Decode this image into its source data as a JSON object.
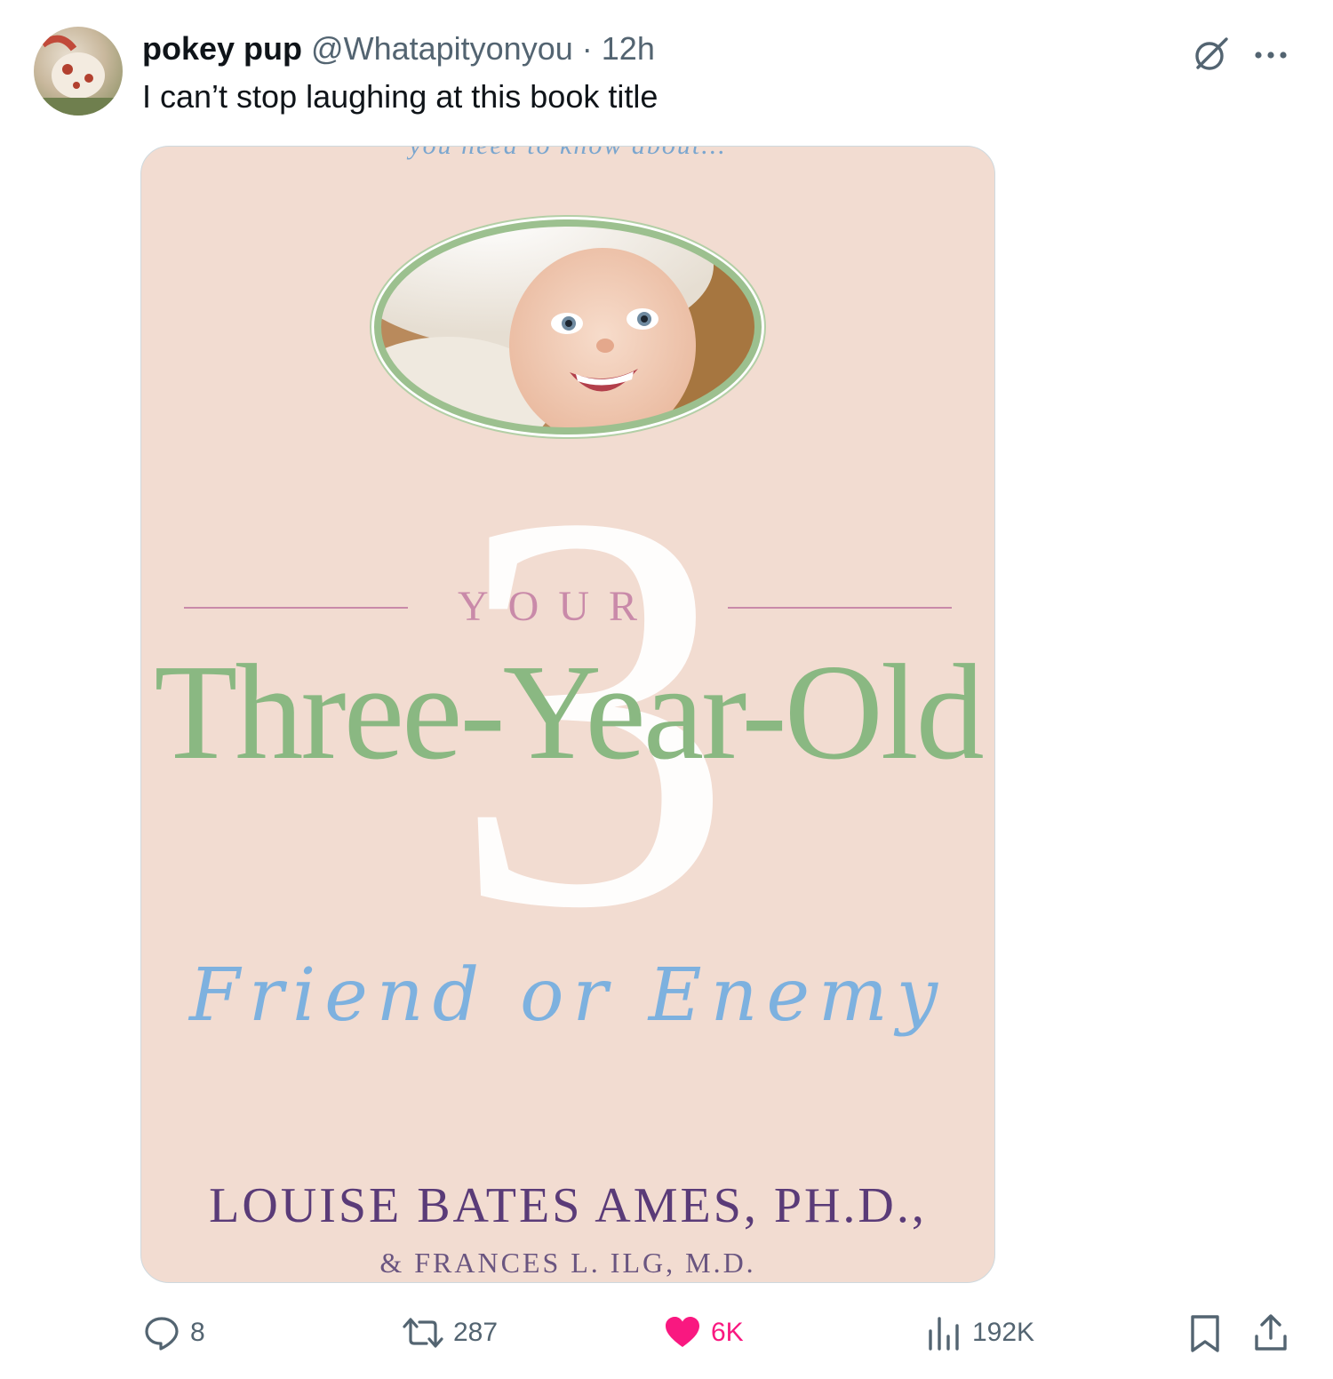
{
  "tweet": {
    "author_name": "pokey pup",
    "handle": "@Whatapityonyou",
    "separator": "·",
    "time": "12h",
    "text": "I can’t stop laughing at this book title"
  },
  "book_cover": {
    "top_partial_text": "you need to know about...",
    "big_numeral": "3",
    "your_label": "YOUR",
    "title": "Three-Year-Old",
    "subtitle": "Friend or Enemy",
    "author": "LOUISE BATES AMES, PH.D.,",
    "coauthor": "& FRANCES L. ILG, M.D."
  },
  "actions": {
    "replies": "8",
    "reposts": "287",
    "likes": "6K",
    "views": "192K"
  },
  "icons": {
    "reply": "reply-icon",
    "repost": "repost-icon",
    "like": "heart-icon",
    "views": "analytics-icon",
    "bookmark": "bookmark-icon",
    "share": "share-icon",
    "grok": "grok-icon",
    "more": "more-icon"
  },
  "colors": {
    "like_active": "#f91880",
    "muted_text": "#536471",
    "cover_background": "#f2dcd1",
    "title_green": "#8ab882",
    "subtitle_blue": "#7db1df",
    "author_purple": "#5a3b78"
  }
}
